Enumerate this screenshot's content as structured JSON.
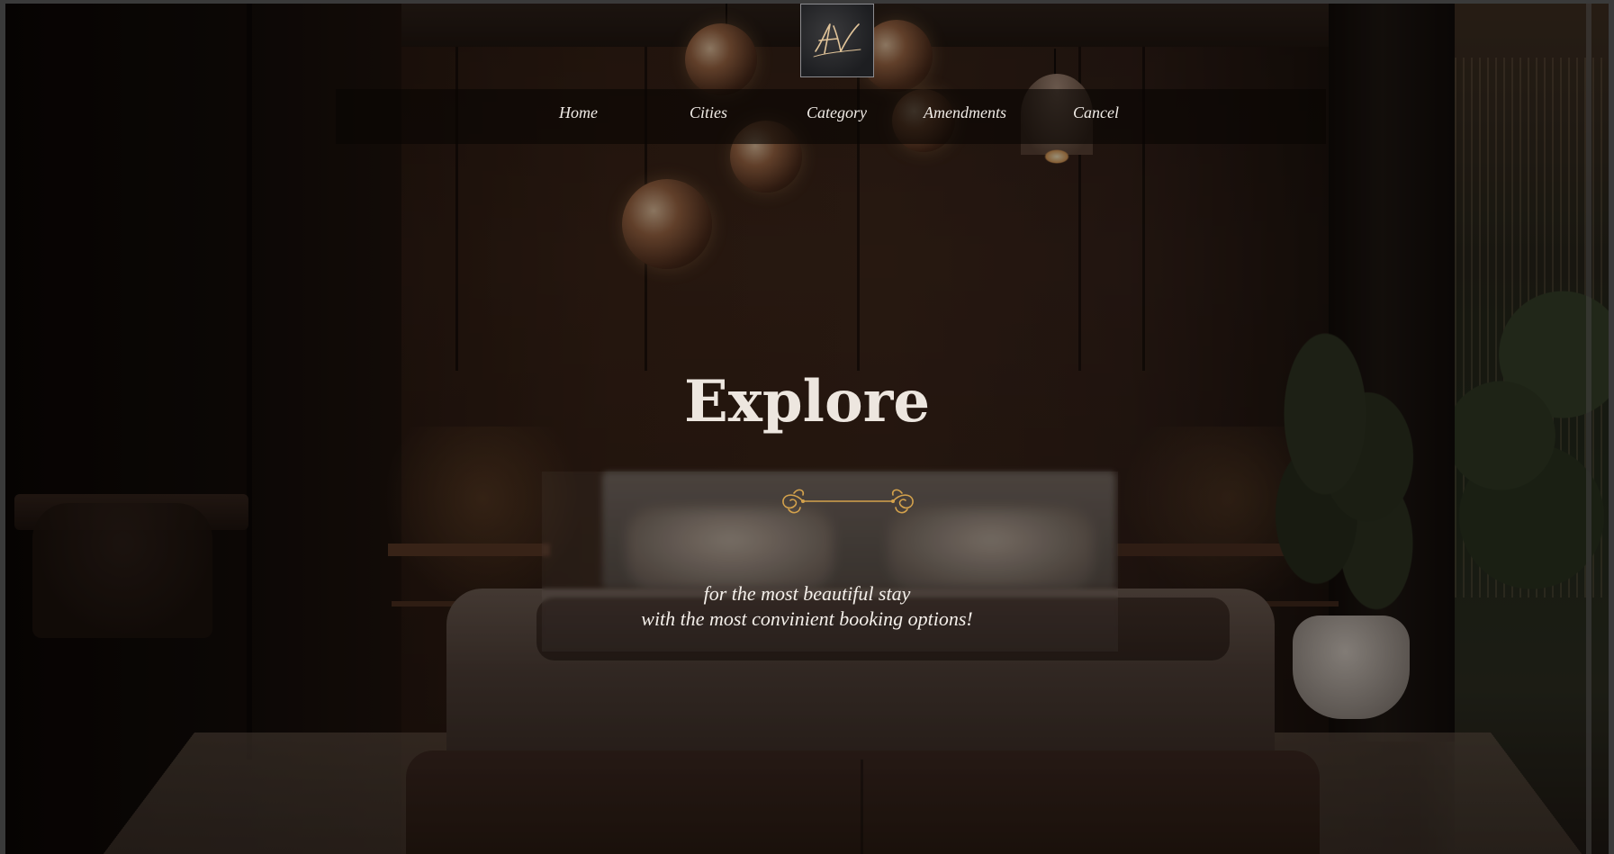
{
  "brand": {
    "logo_icon": "signature-monogram-logo"
  },
  "nav": {
    "items": [
      {
        "label": "Home"
      },
      {
        "label": "Cities"
      },
      {
        "label": "Category"
      },
      {
        "label": "Amendments"
      },
      {
        "label": "Cancel"
      }
    ]
  },
  "hero": {
    "title": "Explore",
    "ornament_icon": "gold-flourish-divider-icon",
    "tagline_line1": "for the most beautiful stay",
    "tagline_line2": "with the most convinient booking options!"
  },
  "colors": {
    "accent_gold": "#d4a24c",
    "text_light": "#ede6df",
    "nav_bg": "#0a0604"
  }
}
